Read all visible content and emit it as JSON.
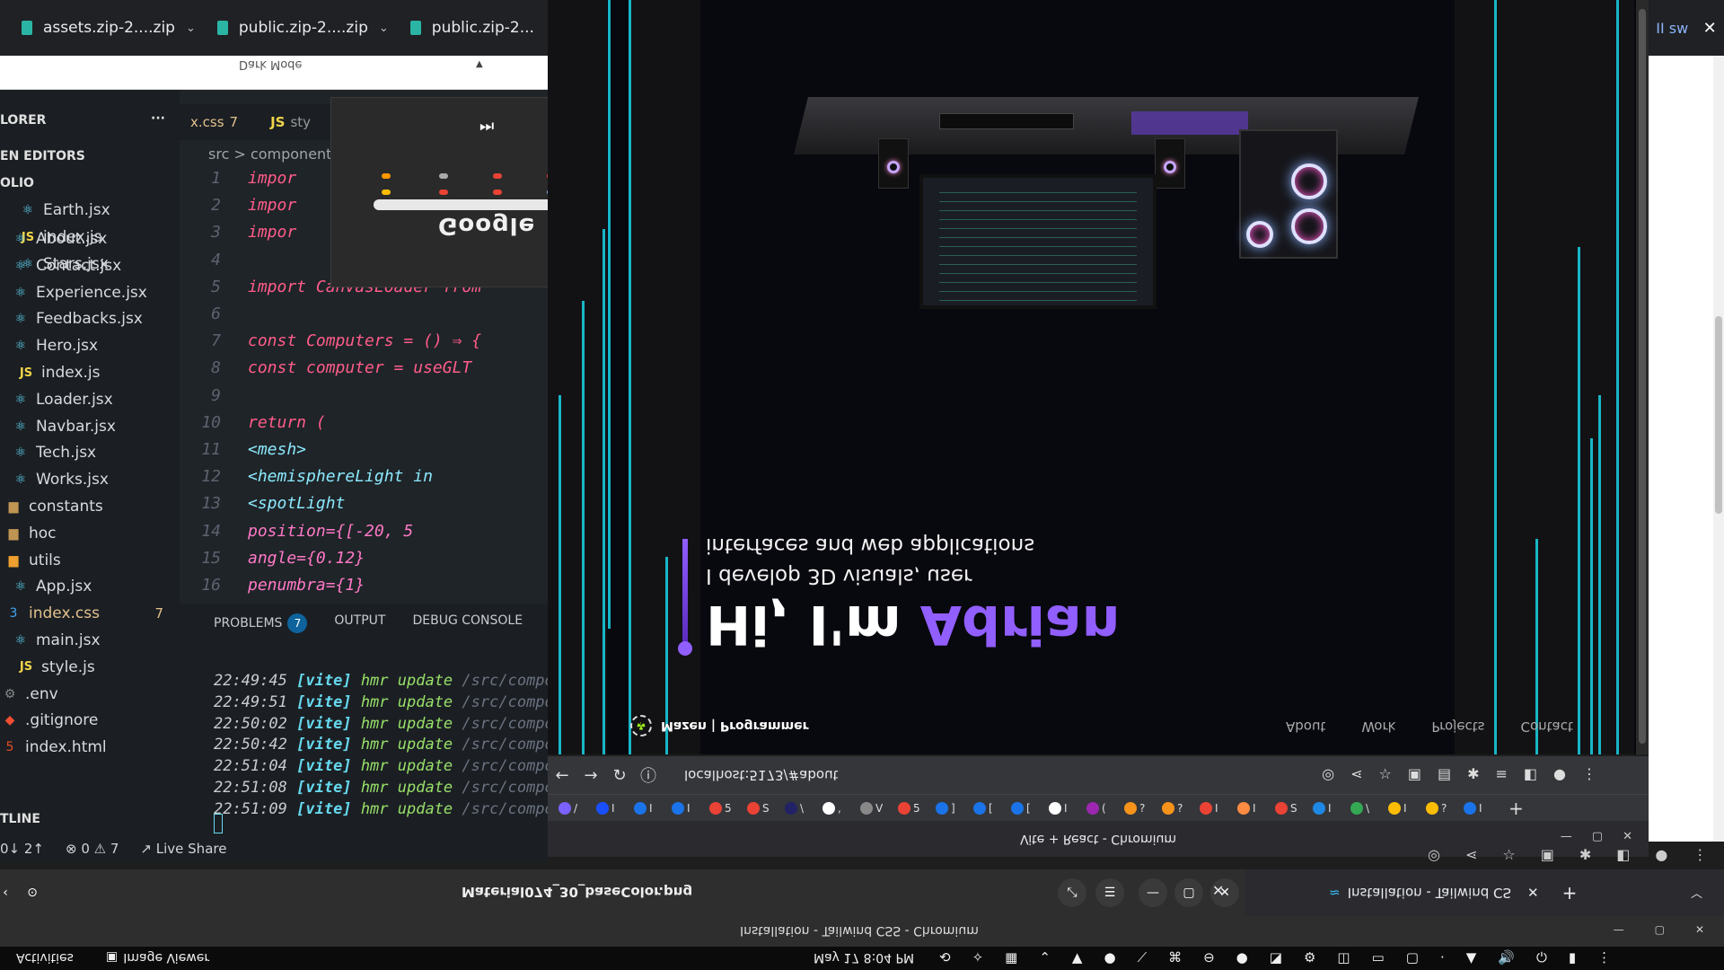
{
  "top_strip": {
    "downloads": [
      {
        "label": "assets.zip-2....zip"
      },
      {
        "label": "public.zip-2....zip"
      },
      {
        "label": "public.zip-2..."
      }
    ],
    "right_label": "II sw",
    "close": "✕"
  },
  "settings_strip": {
    "dark_mode": "Dark Mode"
  },
  "vscode": {
    "explorer_title": "LORER",
    "explorer_more": "···",
    "open_editors": "EN EDITORS",
    "project": "OLIO",
    "files": [
      {
        "name": "Earth.jsx",
        "type": "react"
      },
      {
        "name": "index.js",
        "type": "js"
      },
      {
        "name": "Stars.jsx",
        "type": "react"
      },
      {
        "name": "About.jsx",
        "type": "react"
      },
      {
        "name": "Contact.jsx",
        "type": "react"
      },
      {
        "name": "Experience.jsx",
        "type": "react"
      },
      {
        "name": "Feedbacks.jsx",
        "type": "react"
      },
      {
        "name": "Hero.jsx",
        "type": "react"
      },
      {
        "name": "index.js",
        "type": "js"
      },
      {
        "name": "Loader.jsx",
        "type": "react"
      },
      {
        "name": "Navbar.jsx",
        "type": "react"
      },
      {
        "name": "Tech.jsx",
        "type": "react"
      },
      {
        "name": "Works.jsx",
        "type": "react"
      },
      {
        "name": "constants",
        "type": "folder"
      },
      {
        "name": "hoc",
        "type": "folder"
      },
      {
        "name": "utils",
        "type": "utils"
      },
      {
        "name": "App.jsx",
        "type": "react"
      },
      {
        "name": "index.css",
        "type": "css",
        "badge": "7"
      },
      {
        "name": "main.jsx",
        "type": "react"
      },
      {
        "name": "style.js",
        "type": "js"
      },
      {
        "name": ".env",
        "type": "env"
      },
      {
        "name": ".gitignore",
        "type": "git"
      },
      {
        "name": "index.html",
        "type": "html"
      }
    ],
    "tabs": [
      {
        "label": "x.css",
        "badge": "7"
      },
      {
        "label": "sty",
        "icon": "JS"
      }
    ],
    "breadcrumb": "src > component",
    "code": [
      {
        "n": "1",
        "t": "impor"
      },
      {
        "n": "2",
        "t": "impor"
      },
      {
        "n": "3",
        "t": "impor"
      },
      {
        "n": "4",
        "t": ""
      },
      {
        "n": "5",
        "t": "import CanvasLoader from"
      },
      {
        "n": "6",
        "t": ""
      },
      {
        "n": "7",
        "t": "const Computers = () ⇒ {"
      },
      {
        "n": "8",
        "t": "  const computer = useGLT"
      },
      {
        "n": "9",
        "t": ""
      },
      {
        "n": "10",
        "t": "  return ("
      },
      {
        "n": "11",
        "t": "    <mesh>"
      },
      {
        "n": "12",
        "t": "      <hemisphereLight in"
      },
      {
        "n": "13",
        "t": "      <spotLight"
      },
      {
        "n": "14",
        "t": "        position={[-20, 5"
      },
      {
        "n": "15",
        "t": "        angle={0.12}"
      },
      {
        "n": "16",
        "t": "        penumbra={1}"
      }
    ],
    "panel": {
      "problems": "PROBLEMS",
      "problems_count": "7",
      "output": "OUTPUT",
      "debug": "DEBUG CONSOLE"
    },
    "logs": [
      {
        "time": "22:49:45",
        "tag": "[vite]",
        "msg": "hmr update",
        "path": "/src/compo"
      },
      {
        "time": "22:49:51",
        "tag": "[vite]",
        "msg": "hmr update",
        "path": "/src/compo"
      },
      {
        "time": "22:50:02",
        "tag": "[vite]",
        "msg": "hmr update",
        "path": "/src/compo"
      },
      {
        "time": "22:50:42",
        "tag": "[vite]",
        "msg": "hmr update",
        "path": "/src/compo"
      },
      {
        "time": "22:51:04",
        "tag": "[vite]",
        "msg": "hmr update",
        "path": "/src/compo"
      },
      {
        "time": "22:51:08",
        "tag": "[vite]",
        "msg": "hmr update",
        "path": "/src/compo"
      },
      {
        "time": "22:51:09",
        "tag": "[vite]",
        "msg": "hmr update",
        "path": "/src/compo"
      }
    ],
    "outline": "TLINE",
    "status": {
      "sync": "0↓ 2↑",
      "errors": "0",
      "warnings": "7",
      "live_share": "Live Share"
    }
  },
  "popup": {
    "skip": "⏭",
    "google": "Google",
    "close": "✕"
  },
  "hero": {
    "title_prefix": "Hi, I'm ",
    "title_name": "Adrian",
    "subtitle_1": "I develop 3D visuals, user",
    "subtitle_2": "interfaces and web applications",
    "brand": "Mazen | Programmer",
    "nav": [
      "About",
      "Work",
      "Projects",
      "Contact"
    ]
  },
  "address_bar": {
    "url": "localhost:5173/#about"
  },
  "bookmarks": [
    {
      "label": "/",
      "color": "#7b61ff"
    },
    {
      "label": "I",
      "color": "#1a4fff"
    },
    {
      "label": "I",
      "color": "#1a73e8"
    },
    {
      "label": "I",
      "color": "#1a73e8"
    },
    {
      "label": "5",
      "color": "#ea4335"
    },
    {
      "label": "S",
      "color": "#ea4335"
    },
    {
      "label": "\\",
      "color": "#222266"
    },
    {
      "label": ",",
      "color": "#ffffff"
    },
    {
      "label": "V",
      "color": "#888888"
    },
    {
      "label": "5",
      "color": "#ea4335"
    },
    {
      "label": "]",
      "color": "#1a73e8"
    },
    {
      "label": "[",
      "color": "#1a73e8"
    },
    {
      "label": "[",
      "color": "#1a73e8"
    },
    {
      "label": "I",
      "color": "#ffffff"
    },
    {
      "label": "(",
      "color": "#9c27b0"
    },
    {
      "label": "?",
      "color": "#f7931a"
    },
    {
      "label": "?",
      "color": "#f7931a"
    },
    {
      "label": "I",
      "color": "#ea4335"
    },
    {
      "label": "I",
      "color": "#ff8c42"
    },
    {
      "label": "S",
      "color": "#ea4335"
    },
    {
      "label": "I",
      "color": "#1e88e5"
    },
    {
      "label": "\\",
      "color": "#34a853"
    },
    {
      "label": "I",
      "color": "#fbbc04"
    },
    {
      "label": "?",
      "color": "#fbbc04"
    },
    {
      "label": "I",
      "color": "#1a73e8"
    }
  ],
  "chromium_title": "Vite + React - Chromium",
  "image_viewer": {
    "title": "Material074_30_baseColor.png"
  },
  "second_chromium": {
    "tab": "Installation - Tailwind CS",
    "title": "Installation - Tailwind CSS - Chromium"
  },
  "gnome": {
    "activities": "Activities",
    "app": "Image Viewer",
    "clock": "May 17  8:04 PM"
  },
  "colors": {
    "accent": "#915eff",
    "neon": "#19d4e6"
  }
}
